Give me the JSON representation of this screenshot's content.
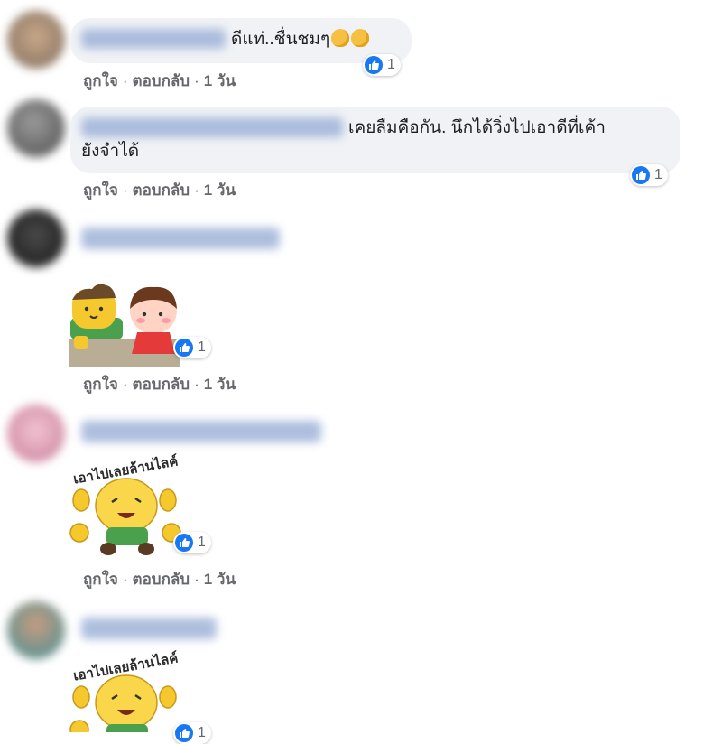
{
  "colors": {
    "bubble": "#f0f2f5",
    "meta": "#65676b",
    "like": "#1877f2"
  },
  "comments": [
    {
      "text": "ดีแท่..ชื่นชมๆ",
      "emoji": [
        "clapping-hands",
        "clapping-hands"
      ],
      "reactions": "1",
      "actions": {
        "like": "ถูกใจ",
        "reply": "ตอบกลับ",
        "time": "1 วัน"
      }
    },
    {
      "text_line1": "เคยลืมคือกัน. นึกได้วิ่งไปเอาดีที่เค้า",
      "text_line2": "ยังจำได้",
      "reactions": "1",
      "actions": {
        "like": "ถูกใจ",
        "reply": "ตอบกลับ",
        "time": "1 วัน"
      }
    },
    {
      "sticker": "two-cartoon-kids-sticker",
      "reactions": "1",
      "actions": {
        "like": "ถูกใจ",
        "reply": "ตอบกลับ",
        "time": "1 วัน"
      }
    },
    {
      "sticker": "cheering-boy-sticker",
      "sticker_text": "เอาไปเลยล้านไลค์",
      "reactions": "1",
      "actions": {
        "like": "ถูกใจ",
        "reply": "ตอบกลับ",
        "time": "1 วัน"
      }
    },
    {
      "sticker": "cheering-boy-sticker",
      "sticker_text": "เอาไปเลยล้านไลค์",
      "reactions": "1"
    }
  ]
}
